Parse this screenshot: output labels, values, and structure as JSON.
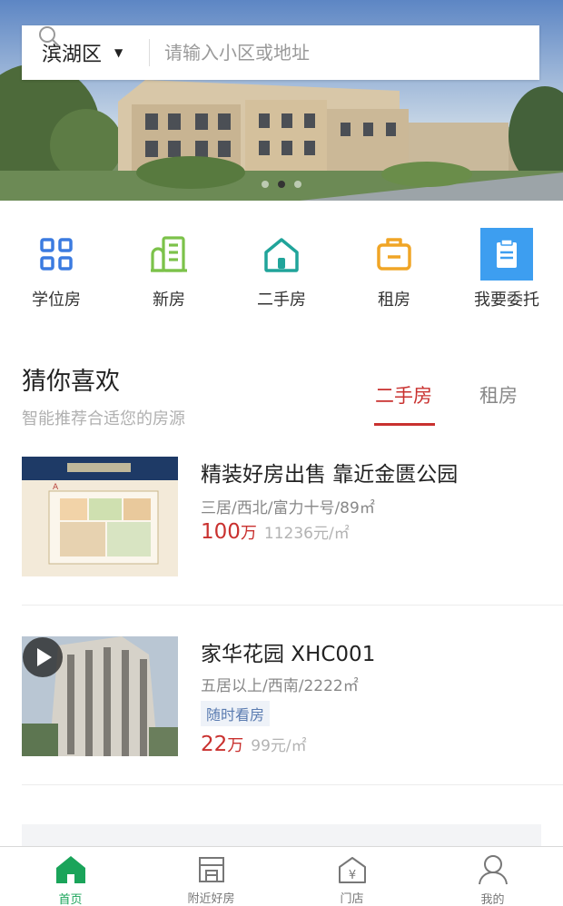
{
  "search": {
    "district": "滨湖区",
    "placeholder": "请输入小区或地址"
  },
  "banner": {
    "dots": 3,
    "active_dot": 1
  },
  "categories": [
    {
      "label": "学位房",
      "icon": "grid-icon",
      "color": "#3b7be0"
    },
    {
      "label": "新房",
      "icon": "building-icon",
      "color": "#7cc24a"
    },
    {
      "label": "二手房",
      "icon": "house-icon",
      "color": "#20a49a"
    },
    {
      "label": "租房",
      "icon": "suitcase-icon",
      "color": "#f0a526"
    },
    {
      "label": "我要委托",
      "icon": "clipboard-icon",
      "color": "#3d9ef0"
    }
  ],
  "recommend": {
    "title": "猜你喜欢",
    "subtitle": "智能推荐合适您的房源",
    "tabs": [
      "二手房",
      "租房"
    ],
    "active_tab": "二手房"
  },
  "listings": [
    {
      "title": "精装好房出售 靠近金匮公园",
      "info": "三居/西北/富力十号/89㎡",
      "price": "100",
      "price_unit": "万",
      "unit_price": "11236元/㎡",
      "tag": ""
    },
    {
      "title": "家华花园 XHC001",
      "info": "五居以上/西南/2222㎡",
      "tag": "随时看房",
      "price": "22",
      "price_unit": "万",
      "unit_price": "99元/㎡",
      "has_video": true
    }
  ],
  "nav": [
    {
      "label": "首页",
      "icon": "home-icon",
      "active": true
    },
    {
      "label": "附近好房",
      "icon": "store-icon",
      "active": false
    },
    {
      "label": "门店",
      "icon": "shop-yen-icon",
      "active": false
    },
    {
      "label": "我的",
      "icon": "user-icon",
      "active": false
    }
  ],
  "colors": {
    "accent_red": "#c9312f",
    "nav_active": "#1aa45a",
    "tag_blue": "#5a7bb0"
  }
}
